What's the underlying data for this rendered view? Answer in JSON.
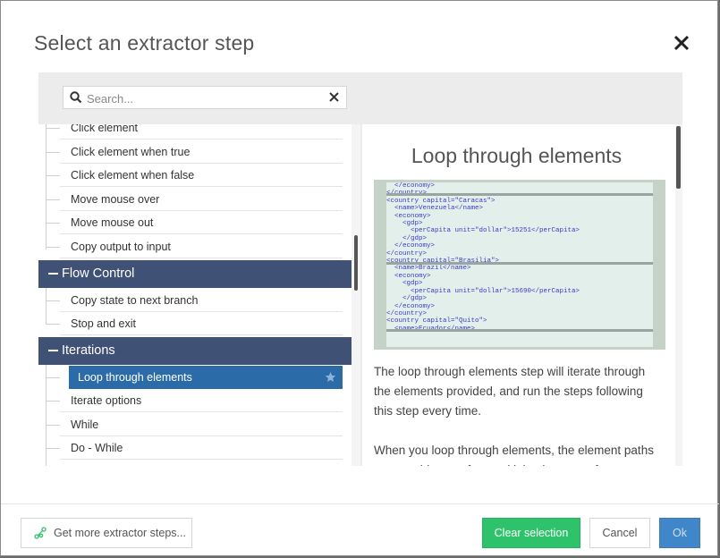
{
  "dialog": {
    "title": "Select an extractor step"
  },
  "search": {
    "placeholder": "Search...",
    "value": ""
  },
  "list": {
    "items_top": [
      {
        "label": "Click element"
      },
      {
        "label": "Click element when true"
      },
      {
        "label": "Click element when false"
      },
      {
        "label": "Move mouse over"
      },
      {
        "label": "Move mouse out"
      },
      {
        "label": "Copy output to input"
      }
    ],
    "group_flow": {
      "label": "Flow Control"
    },
    "items_flow": [
      {
        "label": "Copy state to next branch"
      },
      {
        "label": "Stop and exit"
      }
    ],
    "group_iter": {
      "label": "Iterations"
    },
    "selected": {
      "label": "Loop through elements"
    },
    "items_iter": [
      {
        "label": "Iterate options"
      },
      {
        "label": "While"
      },
      {
        "label": "Do - While"
      }
    ]
  },
  "preview": {
    "title": "Loop through elements",
    "code_lines": [
      "  </economy>",
      "</country>",
      "<country capital=\"Caracas\">",
      "  <name>Venezuela</name>",
      "  <economy>",
      "    <gdp>",
      "      <perCapita unit=\"dollar\">15251</perCapita>",
      "    </gdp>",
      "  </economy>",
      "</country>",
      "<country capital=\"Brasilia\">",
      "  <name>Brazil</name>",
      "  <economy>",
      "    <gdp>",
      "      <perCapita unit=\"dollar\">15690</perCapita>",
      "    </gdp>",
      "  </economy>",
      "</country>",
      "<country capital=\"Quito\">",
      "  <name>Ecuador</name>"
    ],
    "paragraph1": "The loop through elements step will iterate through the elements provided, and run the steps following this step every time.",
    "paragraph2": "When you loop through elements, the element paths you provide are often multiple elements of"
  },
  "footer": {
    "more_label": "Get more extractor steps...",
    "clear_label": "Clear selection",
    "cancel_label": "Cancel",
    "ok_label": "Ok"
  },
  "colors": {
    "group_header": "#3f5175",
    "selected_item": "#2b6ca8",
    "clear_button": "#2ec36a",
    "ok_button": "#3f87c9"
  },
  "icons": {
    "close": "close-icon",
    "search": "search-icon",
    "clear": "clear-search-icon",
    "star": "star-icon",
    "more": "share-nodes-icon"
  }
}
